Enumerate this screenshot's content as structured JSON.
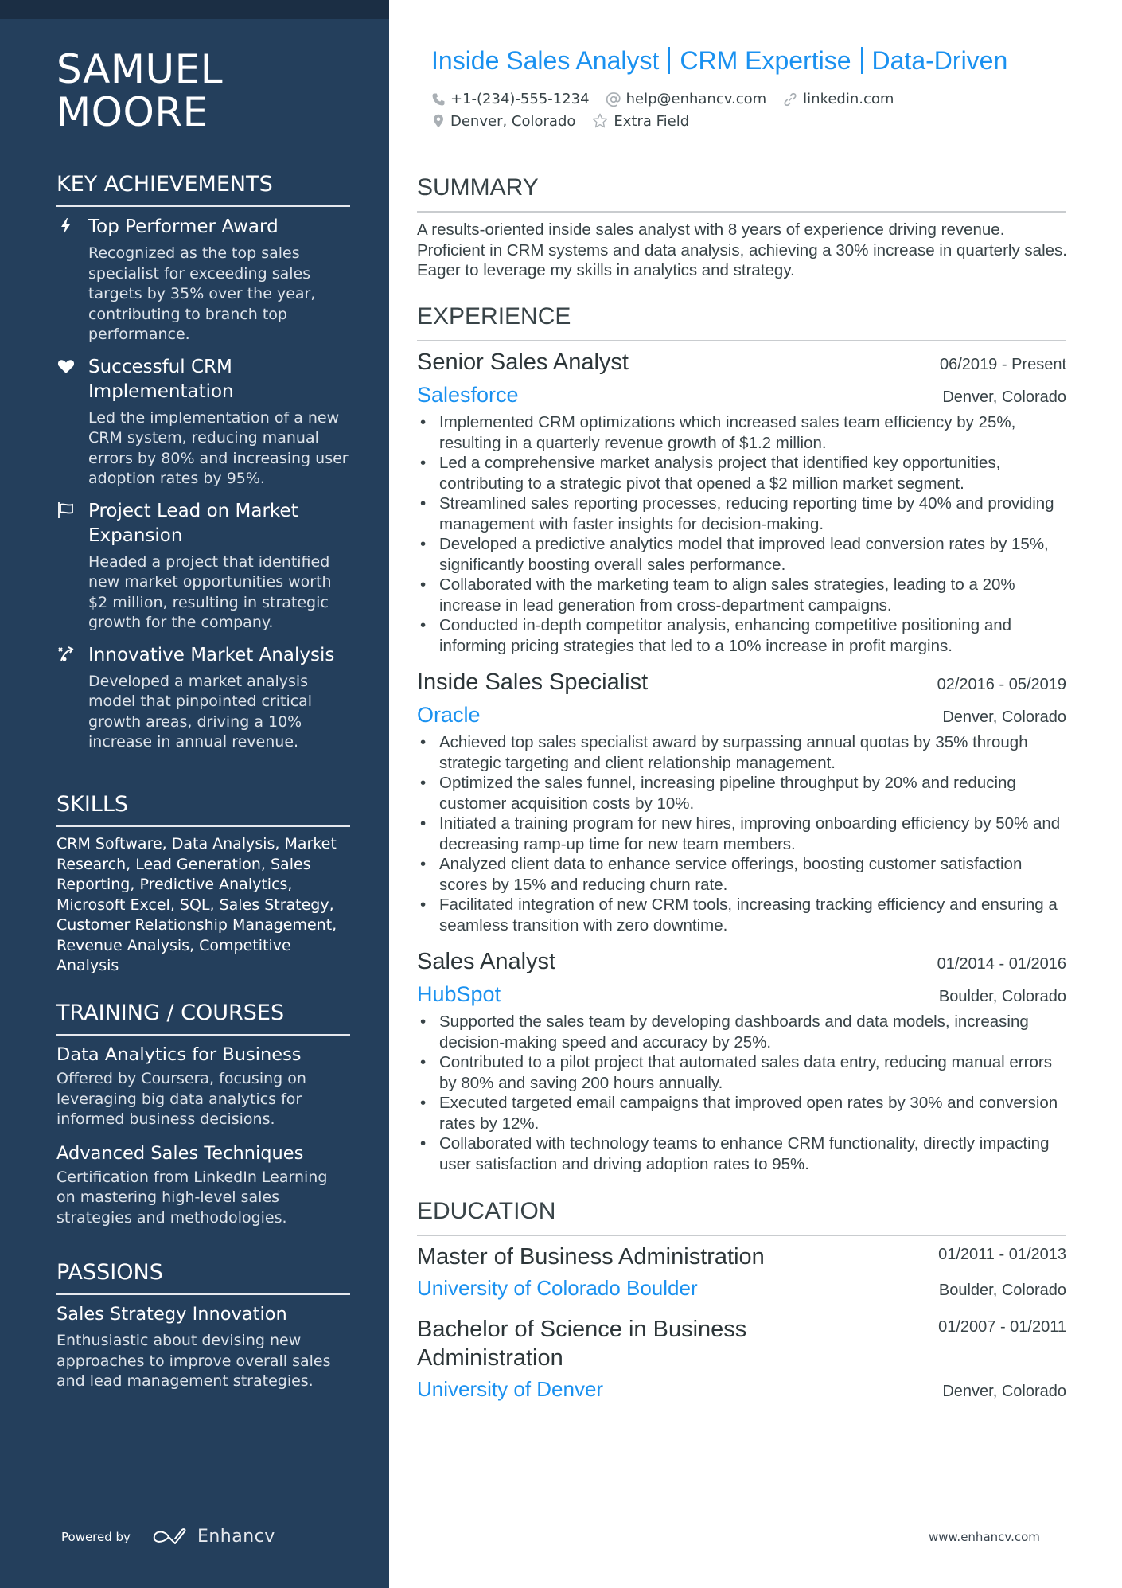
{
  "profile": {
    "first_name": "SAMUEL",
    "last_name": "MOORE",
    "headline_parts": [
      "Inside Sales Analyst",
      "CRM Expertise",
      "Data-Driven"
    ],
    "phone": "+1-(234)-555-1234",
    "email": "help@enhancv.com",
    "link": "linkedin.com",
    "location": "Denver, Colorado",
    "extra": "Extra Field"
  },
  "colors": {
    "sidebar": "#243f5c",
    "sidebar_top": "#1b2e44",
    "accent": "#1a91f0",
    "text": "#384347"
  },
  "sidebar": {
    "achievements_title": "KEY ACHIEVEMENTS",
    "achievements": [
      {
        "icon": "lightning-icon",
        "title": "Top Performer Award",
        "desc": "Recognized as the top sales specialist for exceeding sales targets by 35% over the year, contributing to branch top performance."
      },
      {
        "icon": "heart-icon",
        "title": "Successful CRM Implementation",
        "desc": "Led the implementation of a new CRM system, reducing manual errors by 80% and increasing user adoption rates by 95%."
      },
      {
        "icon": "flag-icon",
        "title": "Project Lead on Market Expansion",
        "desc": "Headed a project that identified new market opportunities worth $2 million, resulting in strategic growth for the company."
      },
      {
        "icon": "strategy-icon",
        "title": "Innovative Market Analysis",
        "desc": "Developed a market analysis model that pinpointed critical growth areas, driving a 10% increase in annual revenue."
      }
    ],
    "skills_title": "SKILLS",
    "skills": "CRM Software, Data Analysis, Market Research, Lead Generation, Sales Reporting, Predictive Analytics, Microsoft Excel, SQL, Sales Strategy, Customer Relationship Management, Revenue Analysis, Competitive Analysis",
    "training_title": "TRAINING / COURSES",
    "courses": [
      {
        "title": "Data Analytics for Business",
        "desc": "Offered by Coursera, focusing on leveraging big data analytics for informed business decisions."
      },
      {
        "title": "Advanced Sales Techniques",
        "desc": "Certification from LinkedIn Learning on mastering high-level sales strategies and methodologies."
      }
    ],
    "passions_title": "PASSIONS",
    "passions": [
      {
        "title": "Sales Strategy Innovation",
        "desc": "Enthusiastic about devising new approaches to improve overall sales and lead management strategies."
      }
    ]
  },
  "summary": {
    "title": "SUMMARY",
    "text": "A results-oriented inside sales analyst with 8 years of experience driving revenue. Proficient in CRM systems and data analysis, achieving a 30% increase in quarterly sales. Eager to leverage my skills in analytics and strategy."
  },
  "experience": {
    "title": "EXPERIENCE",
    "jobs": [
      {
        "title": "Senior Sales Analyst",
        "dates": "06/2019 - Present",
        "company": "Salesforce",
        "location": "Denver, Colorado",
        "bullets": [
          "Implemented CRM optimizations which increased sales team efficiency by 25%, resulting in a quarterly revenue growth of $1.2 million.",
          "Led a comprehensive market analysis project that identified key opportunities, contributing to a strategic pivot that opened a $2 million market segment.",
          "Streamlined sales reporting processes, reducing reporting time by 40% and providing management with faster insights for decision-making.",
          "Developed a predictive analytics model that improved lead conversion rates by 15%, significantly boosting overall sales performance.",
          "Collaborated with the marketing team to align sales strategies, leading to a 20% increase in lead generation from cross-department campaigns.",
          "Conducted in-depth competitor analysis, enhancing competitive positioning and informing pricing strategies that led to a 10% increase in profit margins."
        ]
      },
      {
        "title": "Inside Sales Specialist",
        "dates": "02/2016 - 05/2019",
        "company": "Oracle",
        "location": "Denver, Colorado",
        "bullets": [
          "Achieved top sales specialist award by surpassing annual quotas by 35% through strategic targeting and client relationship management.",
          "Optimized the sales funnel, increasing pipeline throughput by 20% and reducing customer acquisition costs by 10%.",
          "Initiated a training program for new hires, improving onboarding efficiency by 50% and decreasing ramp-up time for new team members.",
          "Analyzed client data to enhance service offerings, boosting customer satisfaction scores by 15% and reducing churn rate.",
          "Facilitated integration of new CRM tools, increasing tracking efficiency and ensuring a seamless transition with zero downtime."
        ]
      },
      {
        "title": "Sales Analyst",
        "dates": "01/2014 - 01/2016",
        "company": "HubSpot",
        "location": "Boulder, Colorado",
        "bullets": [
          "Supported the sales team by developing dashboards and data models, increasing decision-making speed and accuracy by 25%.",
          "Contributed to a pilot project that automated sales data entry, reducing manual errors by 80% and saving 200 hours annually.",
          "Executed targeted email campaigns that improved open rates by 30% and conversion rates by 12%.",
          "Collaborated with technology teams to enhance CRM functionality, directly impacting user satisfaction and driving adoption rates to 95%."
        ]
      }
    ]
  },
  "education": {
    "title": "EDUCATION",
    "items": [
      {
        "degree": "Master of Business Administration",
        "dates": "01/2011 - 01/2013",
        "school": "University of Colorado Boulder",
        "location": "Boulder, Colorado"
      },
      {
        "degree": "Bachelor of Science in Business Administration",
        "dates": "01/2007 - 01/2011",
        "school": "University of Denver",
        "location": "Denver, Colorado"
      }
    ]
  },
  "footer": {
    "powered_by": "Powered by",
    "brand": "Enhancv",
    "website": "www.enhancv.com"
  }
}
